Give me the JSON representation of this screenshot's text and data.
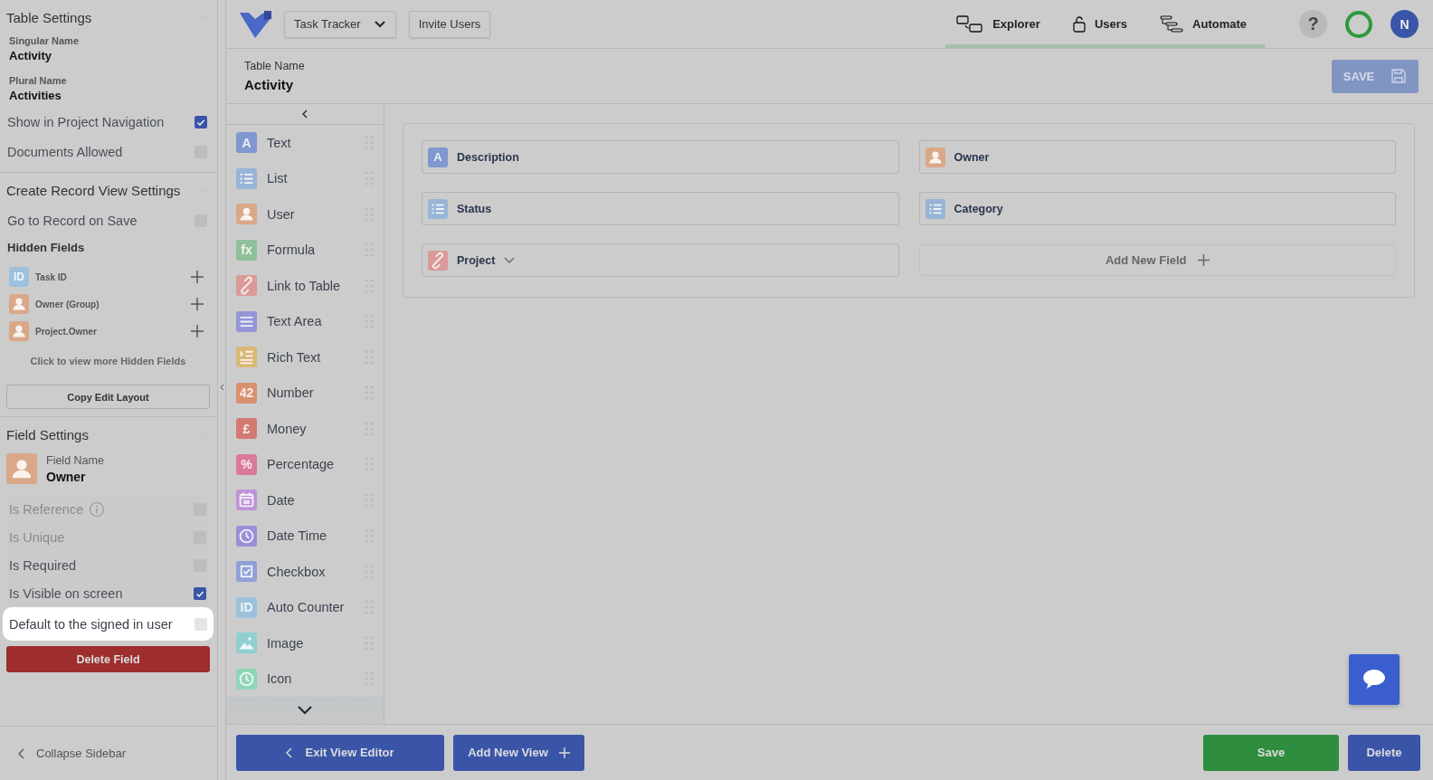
{
  "sidebar": {
    "table_settings": {
      "title": "Table Settings",
      "singular_label": "Singular Name",
      "singular_value": "Activity",
      "plural_label": "Plural Name",
      "plural_value": "Activities",
      "options": [
        {
          "label": "Show in Project Navigation",
          "checked": true
        },
        {
          "label": "Documents Allowed",
          "checked": false
        }
      ]
    },
    "record_view_settings": {
      "title": "Create Record View Settings",
      "options": [
        {
          "label": "Go to Record on Save",
          "checked": false
        }
      ],
      "hidden_fields_title": "Hidden Fields",
      "hidden_fields": [
        {
          "label": "Task ID",
          "kind": "letter",
          "glyph": "ID",
          "color": "#9dc1dc"
        },
        {
          "label": "Owner (Group)",
          "kind": "user",
          "color": "#d9a888"
        },
        {
          "label": "Project.Owner",
          "kind": "user",
          "color": "#d9a888"
        }
      ],
      "more_link": "Click to view more Hidden Fields",
      "copy_button": "Copy Edit Layout"
    },
    "field_settings": {
      "title": "Field Settings",
      "kind": "user",
      "color": "#d9a888",
      "name_label": "Field Name",
      "name_value": "Owner",
      "options": [
        {
          "label": "Is Reference",
          "info": true,
          "checked": false,
          "disabled": true,
          "highlighted": false
        },
        {
          "label": "Is Unique",
          "info": false,
          "checked": false,
          "disabled": true,
          "highlighted": false
        },
        {
          "label": "Is Required",
          "info": false,
          "checked": false,
          "disabled": false,
          "highlighted": false
        },
        {
          "label": "Is Visible on screen",
          "info": false,
          "checked": true,
          "disabled": false,
          "highlighted": false
        },
        {
          "label": "Default to the signed in user",
          "info": false,
          "checked": false,
          "disabled": false,
          "highlighted": true
        }
      ],
      "delete_button": "Delete Field"
    },
    "collapse": "Collapse Sidebar"
  },
  "topbar": {
    "app_selector": "Task Tracker",
    "invite": "Invite Users",
    "nav": [
      {
        "label": "Explorer",
        "kind": "explorer"
      },
      {
        "label": "Users",
        "kind": "lock"
      },
      {
        "label": "Automate",
        "kind": "automate"
      }
    ],
    "help": "?",
    "avatar": "N"
  },
  "header": {
    "label": "Table Name",
    "value": "Activity",
    "save": {
      "label": "SAVE",
      "disabled": true
    }
  },
  "palette": [
    {
      "label": "Text",
      "kind": "letter",
      "glyph": "A",
      "color": "#7f98cf"
    },
    {
      "label": "List",
      "kind": "list",
      "color": "#98b4d6"
    },
    {
      "label": "User",
      "kind": "user",
      "color": "#d9a888"
    },
    {
      "label": "Formula",
      "kind": "letter",
      "glyph": "fx",
      "color": "#8fc09a"
    },
    {
      "label": "Link to Table",
      "kind": "link",
      "color": "#d99a98"
    },
    {
      "label": "Text Area",
      "kind": "lines",
      "color": "#9494d6"
    },
    {
      "label": "Rich Text",
      "kind": "rich",
      "color": "#d9b878"
    },
    {
      "label": "Number",
      "kind": "letter",
      "glyph": "42",
      "color": "#d9906e"
    },
    {
      "label": "Money",
      "kind": "letter",
      "glyph": "£",
      "color": "#d27a72"
    },
    {
      "label": "Percentage",
      "kind": "letter",
      "glyph": "%",
      "color": "#d87a98"
    },
    {
      "label": "Date",
      "kind": "calendar",
      "color": "#bf93d6"
    },
    {
      "label": "Date Time",
      "kind": "clock",
      "color": "#9a8fd6"
    },
    {
      "label": "Checkbox",
      "kind": "check",
      "color": "#8fa0d6"
    },
    {
      "label": "Auto Counter",
      "kind": "letter",
      "glyph": "ID",
      "color": "#9dc1dc"
    },
    {
      "label": "Image",
      "kind": "image",
      "color": "#8fcfcf"
    },
    {
      "label": "Icon",
      "kind": "clock",
      "color": "#8fd6b8"
    }
  ],
  "layout_fields": [
    {
      "label": "Description",
      "kind": "letter",
      "glyph": "A",
      "color": "#7f98cf",
      "dropdown": false
    },
    {
      "label": "Owner",
      "kind": "user",
      "color": "#d9a888",
      "dropdown": false
    },
    {
      "label": "Status",
      "kind": "list",
      "color": "#98b4d6",
      "dropdown": false
    },
    {
      "label": "Category",
      "kind": "list",
      "color": "#98b4d6",
      "dropdown": false
    },
    {
      "label": "Project",
      "kind": "link",
      "color": "#d99a98",
      "dropdown": true
    }
  ],
  "add_field": "Add New Field",
  "footer": {
    "exit": "Exit View Editor",
    "add_view": "Add New View",
    "save": "Save",
    "delete": "Delete"
  }
}
